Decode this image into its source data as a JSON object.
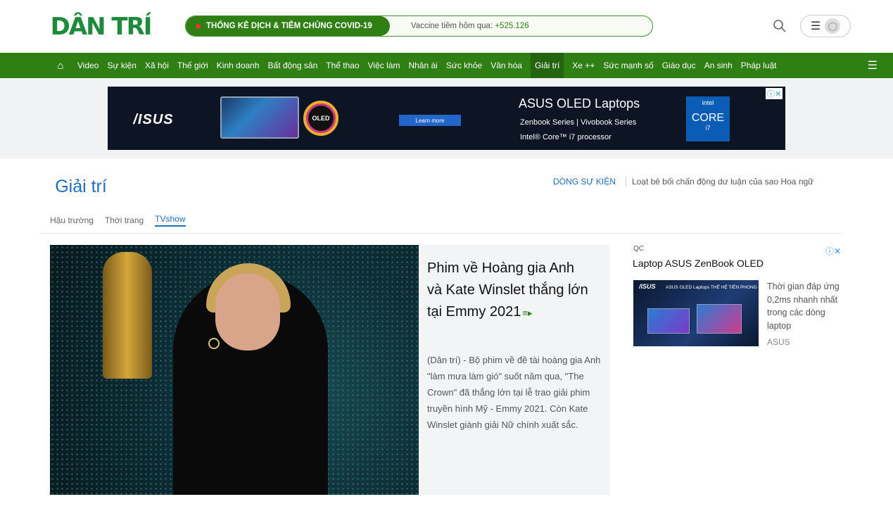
{
  "header": {
    "logo": "DÂN TRÍ",
    "covid": {
      "label": "THỐNG KÊ DỊCH & TIÊM CHỦNG COVID-19",
      "vaccine_text": "Vaccine tiêm hôm qua:",
      "vaccine_value": "+525.126"
    }
  },
  "nav": {
    "items": [
      "Video",
      "Sự kiện",
      "Xã hội",
      "Thế giới",
      "Kinh doanh",
      "Bất động sản",
      "Thể thao",
      "Việc làm",
      "Nhân ái",
      "Sức khỏe",
      "Văn hóa",
      "Giải trí",
      "Xe ++",
      "Sức mạnh số",
      "Giáo dục",
      "An sinh",
      "Pháp luật"
    ],
    "active": "Giải trí"
  },
  "top_ad": {
    "brand": "/ISUS",
    "oled_badge": "OLED",
    "learn_more": "Learn more",
    "title": "ASUS OLED Laptops",
    "line1": "Zenbook Series | Vivobook Series",
    "line2": "Intel® Core™ i7 processor",
    "intel_top": "intel",
    "intel_core": "CORE",
    "intel_gen": "i7",
    "close": "ⓘ✕"
  },
  "section": {
    "title": "Giải trí",
    "event_label": "DÒNG SỰ KIỆN",
    "event_text": "Loạt bê bối chấn động dư luận của sao Hoa ngữ",
    "subtabs": [
      "Hậu trường",
      "Thời trang",
      "TVshow"
    ],
    "active_subtab": "TVshow"
  },
  "feature": {
    "title": "Phim về Hoàng gia Anh và Kate Winslet thắng lớn tại Emmy 2021",
    "summary": "(Dân trí) - Bộ phim về đề tài hoàng gia Anh \"làm mưa làm gió\" suốt năm qua, \"The Crown\" đã thắng lớn tại lễ trao giải phim truyền hình Mỹ - Emmy 2021. Còn Kate Winslet giành giải Nữ chính xuất sắc."
  },
  "right_ad": {
    "qc": "QC",
    "title": "Laptop ASUS ZenBook OLED",
    "image_brand": "/ISUS",
    "image_caption": "ASUS OLED Laptops\nTHẾ HỆ TIÊN PHONG",
    "desc": "Thời gian đáp ứng 0,2ms nhanh nhất trong các dòng laptop",
    "brand": "ASUS",
    "close": "ⓘ✕"
  }
}
